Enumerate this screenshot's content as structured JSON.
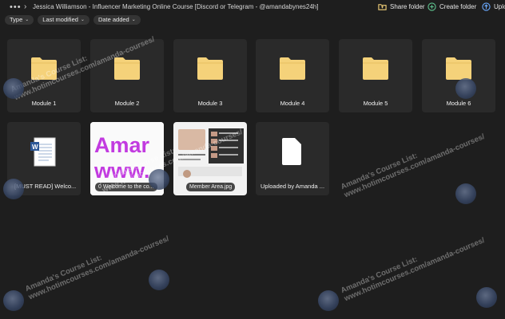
{
  "topbar": {
    "more_label": "•••",
    "breadcrumb": "Jessica Williamson - Influencer Marketing Online Course [Discord or Telegram - @amandabynes24h]",
    "share_folder": "Share folder",
    "create_folder": "Create folder",
    "upload": "Uplo"
  },
  "filters": [
    {
      "label": "Type"
    },
    {
      "label": "Last modified"
    },
    {
      "label": "Date added"
    }
  ],
  "folders": [
    {
      "name": "Module 1"
    },
    {
      "name": "Module 2"
    },
    {
      "name": "Module 3"
    },
    {
      "name": "Module 4"
    },
    {
      "name": "Module 5"
    },
    {
      "name": "Module 6"
    }
  ],
  "files": [
    {
      "name": "[MUST READ] Welco..."
    },
    {
      "name": "0 Welcome to the co...",
      "preview_line1": "Amar",
      "preview_line2": "www."
    },
    {
      "name": "Member Area.jpg"
    },
    {
      "name": "Uploaded by Amanda ..."
    }
  ],
  "watermark": {
    "line1": "Amanda's Course List:",
    "line2": "www.hotimcourses.com/amanda-courses/"
  },
  "colors": {
    "background": "#1e1e1e",
    "card": "#2a2a2a",
    "folder": "#f5d27a",
    "preview_text": "#c23be0",
    "word_blue": "#2b5797"
  }
}
